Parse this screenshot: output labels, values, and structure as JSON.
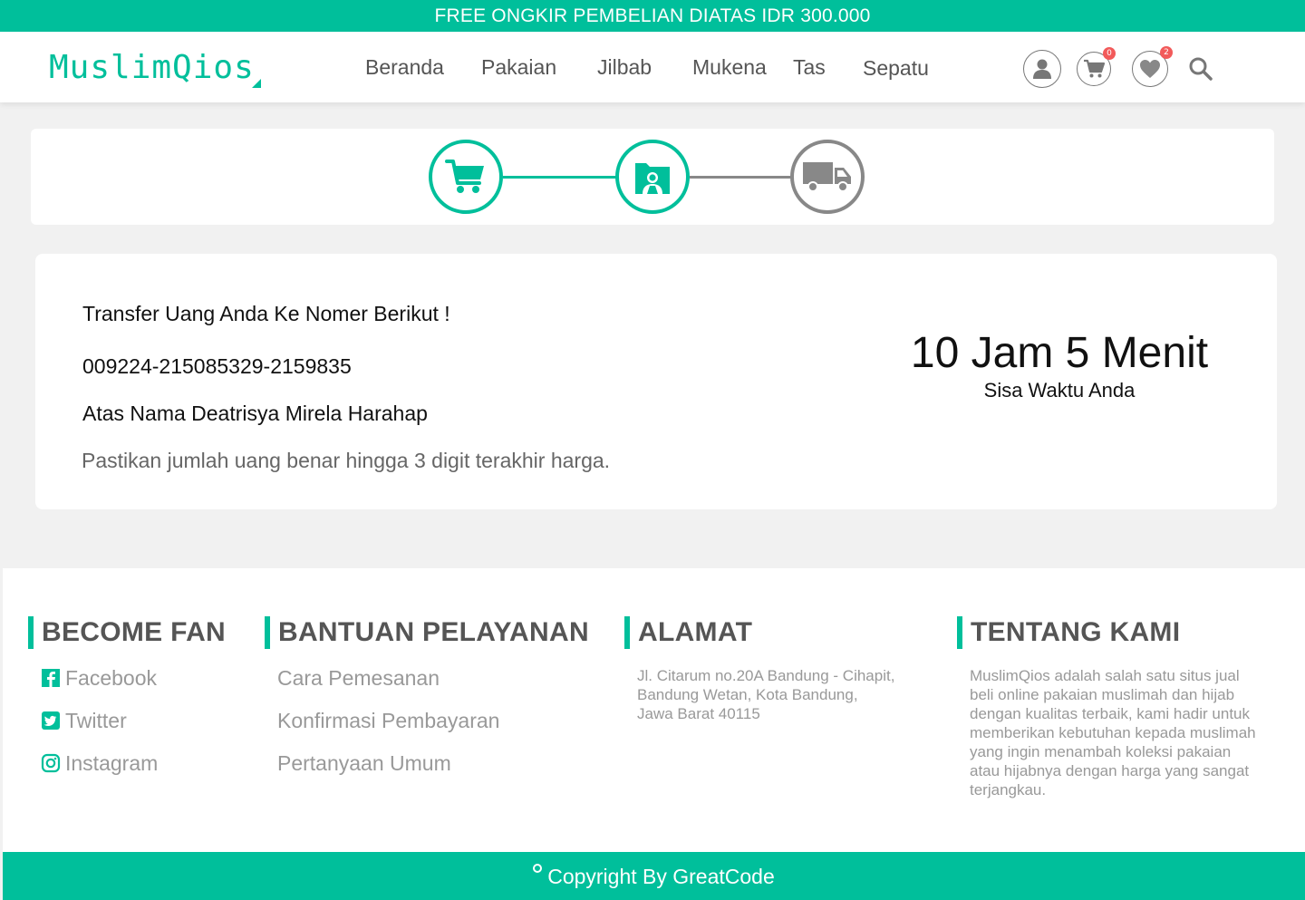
{
  "topbar": {
    "text": "FREE ONGKIR PEMBELIAN DIATAS IDR 300.000"
  },
  "header": {
    "logo": "MuslimQios",
    "nav": [
      "Beranda",
      "Pakaian",
      "Jilbab",
      "Mukena",
      "Tas",
      "Sepatu"
    ],
    "cart_count": "0",
    "wishlist_count": "2"
  },
  "steps": {
    "items": [
      {
        "icon": "cart-icon",
        "state": "done"
      },
      {
        "icon": "payment-folder-icon",
        "state": "active"
      },
      {
        "icon": "truck-icon",
        "state": "pending"
      }
    ]
  },
  "payment": {
    "instruction": "Transfer Uang Anda Ke Nomer Berikut !",
    "account_number": "009224-215085329-2159835",
    "account_name": "Atas Nama Deatrisya Mirela Harahap",
    "note": "Pastikan jumlah uang benar hingga 3 digit terakhir harga.",
    "timer": "10 Jam 5 Menit",
    "timer_label": "Sisa Waktu Anda"
  },
  "footer": {
    "fan": {
      "title": "BECOME FAN",
      "links": [
        {
          "label": "Facebook",
          "icon": "facebook-icon"
        },
        {
          "label": "Twitter",
          "icon": "twitter-icon"
        },
        {
          "label": "Instagram",
          "icon": "instagram-icon"
        }
      ]
    },
    "help": {
      "title": "BANTUAN PELAYANAN",
      "links": [
        "Cara Pemesanan",
        "Konfirmasi Pembayaran",
        "Pertanyaan Umum"
      ]
    },
    "address": {
      "title": "ALAMAT",
      "lines": [
        "Jl. Citarum no.20A Bandung - Cihapit,",
        "Bandung Wetan, Kota Bandung,",
        "Jawa Barat 40115"
      ]
    },
    "about": {
      "title": "TENTANG KAMI",
      "lines": [
        "MuslimQios adalah salah satu situs jual",
        "beli online pakaian muslimah dan hijab",
        "dengan kualitas terbaik, kami hadir untuk",
        "memberikan kebutuhan kepada muslimah",
        "yang ingin menambah koleksi pakaian",
        "atau hijabnya dengan harga yang sangat",
        "terjangkau."
      ]
    }
  },
  "copyright": "Copyright By GreatCode",
  "colors": {
    "accent": "#00bf9b",
    "badge": "#f25a5a",
    "inactive": "#888888"
  }
}
